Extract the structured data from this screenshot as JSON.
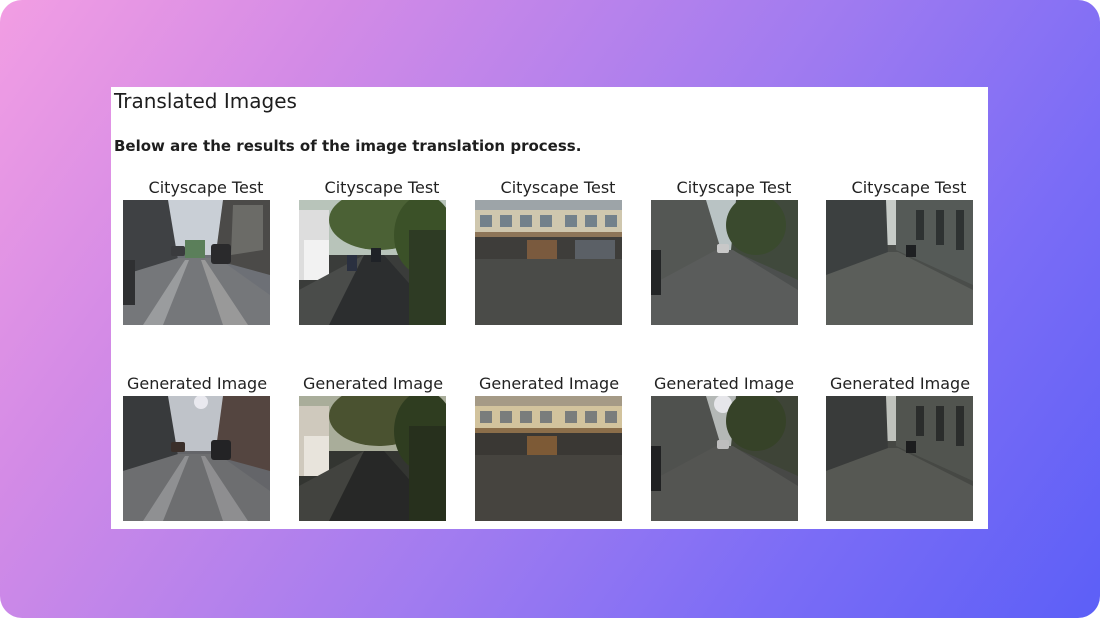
{
  "page": {
    "title": "Translated Images",
    "subtitle": "Below are the results of the image translation process."
  },
  "rows": [
    {
      "caption": "Cityscape Test",
      "images": [
        "street-scene-1",
        "street-scene-2",
        "building-facade-3",
        "street-scene-4",
        "street-scene-5"
      ]
    },
    {
      "caption": "Generated Image",
      "images": [
        "generated-scene-1",
        "generated-scene-2",
        "generated-scene-3",
        "generated-scene-4",
        "generated-scene-5"
      ]
    }
  ],
  "captions": {
    "r0": [
      "Cityscape Test",
      "Cityscape Test",
      "Cityscape Test",
      "Cityscape Test",
      "Cityscape Test"
    ],
    "r1": [
      "Generated Image",
      "Generated Image",
      "Generated Image",
      "Generated Image",
      "Generated Image"
    ]
  },
  "colors": {
    "background_start": "#f29ee3",
    "background_end": "#5c5ff7",
    "card": "#ffffff"
  }
}
